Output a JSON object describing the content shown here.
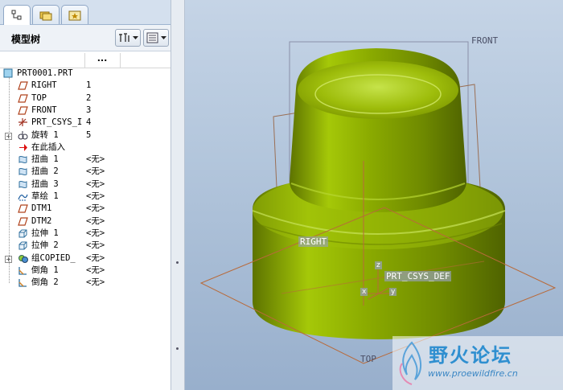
{
  "panel": {
    "title": "模型树"
  },
  "columns": {
    "col2": "..."
  },
  "tree": [
    {
      "label": "PRT0001.PRT",
      "value": "",
      "icon": "part-icon",
      "indent": 0,
      "expander": false
    },
    {
      "label": "RIGHT",
      "value": "1",
      "icon": "datum-plane-icon",
      "indent": 1,
      "expander": false
    },
    {
      "label": "TOP",
      "value": "2",
      "icon": "datum-plane-icon",
      "indent": 1,
      "expander": false
    },
    {
      "label": "FRONT",
      "value": "3",
      "icon": "datum-plane-icon",
      "indent": 1,
      "expander": false
    },
    {
      "label": "PRT_CSYS_I",
      "value": "4",
      "icon": "csys-icon",
      "indent": 1,
      "expander": false
    },
    {
      "label": "旋转 1",
      "value": "5",
      "icon": "revolve-icon",
      "indent": 1,
      "expander": true
    },
    {
      "label": "在此插入",
      "value": "",
      "icon": "insert-arrow-icon",
      "indent": 1,
      "expander": false
    },
    {
      "label": "扭曲 1",
      "value": "<无>",
      "icon": "warp-icon",
      "indent": 1,
      "expander": false
    },
    {
      "label": "扭曲 2",
      "value": "<无>",
      "icon": "warp-icon",
      "indent": 1,
      "expander": false
    },
    {
      "label": "扭曲 3",
      "value": "<无>",
      "icon": "warp-icon",
      "indent": 1,
      "expander": false
    },
    {
      "label": "草绘 1",
      "value": "<无>",
      "icon": "sketch-icon",
      "indent": 1,
      "expander": false
    },
    {
      "label": "DTM1",
      "value": "<无>",
      "icon": "datum-plane-icon",
      "indent": 1,
      "expander": false
    },
    {
      "label": "DTM2",
      "value": "<无>",
      "icon": "datum-plane-icon",
      "indent": 1,
      "expander": false
    },
    {
      "label": "拉伸 1",
      "value": "<无>",
      "icon": "extrude-icon",
      "indent": 1,
      "expander": false
    },
    {
      "label": "拉伸 2",
      "value": "<无>",
      "icon": "extrude-icon",
      "indent": 1,
      "expander": false
    },
    {
      "label": "组COPIED_",
      "value": "<无>",
      "icon": "group-icon",
      "indent": 1,
      "expander": true
    },
    {
      "label": "倒角 1",
      "value": "<无>",
      "icon": "chamfer-icon",
      "indent": 1,
      "expander": false
    },
    {
      "label": "倒角 2",
      "value": "<无>",
      "icon": "chamfer-icon",
      "indent": 1,
      "expander": false
    }
  ],
  "viewport": {
    "labels": {
      "front": "FRONT",
      "right": "RIGHT",
      "top": "TOP",
      "csys": "PRT_CSYS_DEF",
      "x": "x",
      "y": "y",
      "z": "z"
    },
    "colors": {
      "model": "#8fb000",
      "datum_front": "#7a7f9a",
      "datum_lines": "#b0663a"
    }
  },
  "watermark": {
    "text": "野火论坛",
    "url": "www.proewildfire.cn"
  }
}
